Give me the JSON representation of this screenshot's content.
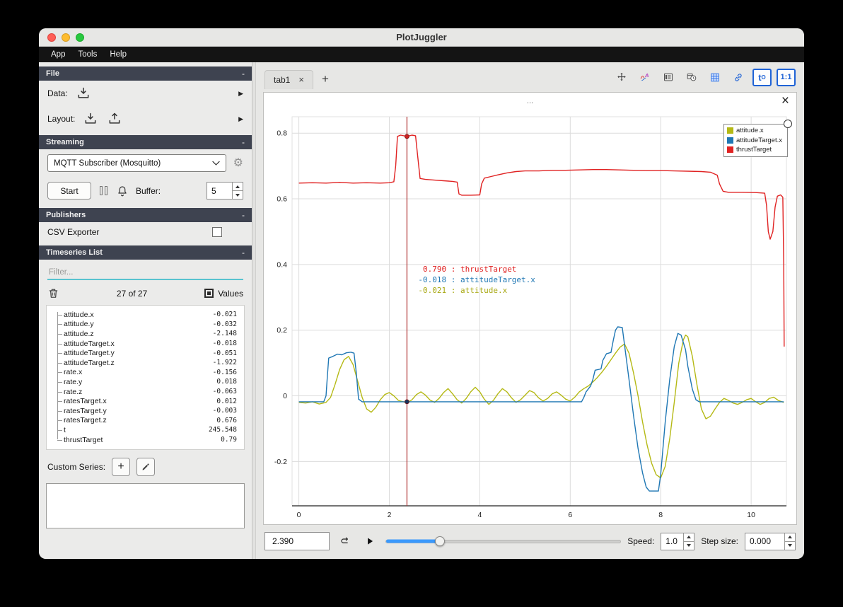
{
  "window": {
    "title": "PlotJuggler"
  },
  "menu": {
    "items": [
      "App",
      "Tools",
      "Help"
    ]
  },
  "icons": {
    "close": "×",
    "plus": "+",
    "expand_arrow": "▶",
    "gear": "⚙"
  },
  "sidebar": {
    "file": {
      "title": "File",
      "collapse": "-",
      "data_label": "Data:",
      "layout_label": "Layout:"
    },
    "streaming": {
      "title": "Streaming",
      "collapse": "-",
      "source": "MQTT Subscriber (Mosquitto)",
      "start_label": "Start",
      "buffer_label": "Buffer:",
      "buffer_value": "5"
    },
    "publishers": {
      "title": "Publishers",
      "collapse": "-",
      "csv_label": "CSV Exporter"
    },
    "timeseries": {
      "title": "Timeseries List",
      "collapse": "-",
      "filter_placeholder": "Filter...",
      "count": "27 of 27",
      "values_label": "Values",
      "items": [
        {
          "name": "attitude.x",
          "value": "-0.021"
        },
        {
          "name": "attitude.y",
          "value": "-0.032"
        },
        {
          "name": "attitude.z",
          "value": "-2.148"
        },
        {
          "name": "attitudeTarget.x",
          "value": "-0.018"
        },
        {
          "name": "attitudeTarget.y",
          "value": "-0.051"
        },
        {
          "name": "attitudeTarget.z",
          "value": "-1.922"
        },
        {
          "name": "rate.x",
          "value": "-0.156"
        },
        {
          "name": "rate.y",
          "value": "0.018"
        },
        {
          "name": "rate.z",
          "value": "-0.063"
        },
        {
          "name": "ratesTarget.x",
          "value": "0.012"
        },
        {
          "name": "ratesTarget.y",
          "value": "-0.003"
        },
        {
          "name": "ratesTarget.z",
          "value": "0.676"
        },
        {
          "name": "t",
          "value": "245.548"
        },
        {
          "name": "thrustTarget",
          "value": "0.79"
        }
      ]
    },
    "custom_series_label": "Custom Series:"
  },
  "main": {
    "tab": {
      "label": "tab1"
    },
    "toolbar": {
      "t0_main": "t",
      "t0_sub": "O",
      "ratio_label": "1:1"
    },
    "plot": {
      "title": "...",
      "legend": [
        {
          "label": "attitude.x",
          "color": "#b5b915"
        },
        {
          "label": "attitudeTarget.x",
          "color": "#1f77b4"
        },
        {
          "label": "thrustTarget",
          "color": "#e02222"
        }
      ],
      "annotation_lines": [
        {
          "text": " 0.790 : thrustTarget",
          "color": "#e02222"
        },
        {
          "text": "-0.018 : attitudeTarget.x",
          "color": "#1f77b4"
        },
        {
          "text": "-0.021 : attitude.x",
          "color": "#a8a812"
        }
      ]
    },
    "controls": {
      "time": "2.390",
      "speed_label": "Speed:",
      "speed": "1.0",
      "step_label": "Step size:",
      "step": "0.000",
      "slider_percent": 23
    }
  },
  "chart_data": {
    "type": "line",
    "title": "...",
    "xlim": [
      -0.15,
      10.78
    ],
    "ylim": [
      -0.335,
      0.85
    ],
    "grid": true,
    "legend_position": "top-right",
    "xticks": [
      {
        "v": 0,
        "label": "0"
      },
      {
        "v": 2,
        "label": "2"
      },
      {
        "v": 4,
        "label": "4"
      },
      {
        "v": 6,
        "label": "6"
      },
      {
        "v": 8,
        "label": "8"
      },
      {
        "v": 10,
        "label": "10"
      }
    ],
    "yticks": [
      {
        "v": -0.2,
        "label": "-0.2"
      },
      {
        "v": 0,
        "label": "0"
      },
      {
        "v": 0.2,
        "label": "0.2"
      },
      {
        "v": 0.4,
        "label": "0.4"
      },
      {
        "v": 0.6,
        "label": "0.6"
      },
      {
        "v": 0.8,
        "label": "0.8"
      }
    ],
    "tracker": {
      "x": 2.39,
      "line_color": "#b03030",
      "dots": [
        {
          "y": 0.79,
          "color": "#c22"
        },
        {
          "y": -0.018,
          "color": "#17345c"
        }
      ]
    },
    "series": [
      {
        "name": "attitude.x",
        "color": "#b5b915",
        "points": [
          [
            0,
            -0.02
          ],
          [
            0.15,
            -0.022
          ],
          [
            0.3,
            -0.018
          ],
          [
            0.45,
            -0.025
          ],
          [
            0.6,
            -0.02
          ],
          [
            0.7,
            -0.005
          ],
          [
            0.8,
            0.035
          ],
          [
            0.9,
            0.08
          ],
          [
            1.0,
            0.11
          ],
          [
            1.1,
            0.12
          ],
          [
            1.2,
            0.095
          ],
          [
            1.3,
            0.045
          ],
          [
            1.4,
            -0.005
          ],
          [
            1.5,
            -0.04
          ],
          [
            1.6,
            -0.05
          ],
          [
            1.7,
            -0.035
          ],
          [
            1.8,
            -0.012
          ],
          [
            1.9,
            0.004
          ],
          [
            2.0,
            0.01
          ],
          [
            2.1,
            0.0
          ],
          [
            2.2,
            -0.014
          ],
          [
            2.39,
            -0.021
          ],
          [
            2.5,
            -0.012
          ],
          [
            2.6,
            0.004
          ],
          [
            2.7,
            0.012
          ],
          [
            2.8,
            0.002
          ],
          [
            2.9,
            -0.013
          ],
          [
            3.0,
            -0.02
          ],
          [
            3.1,
            -0.008
          ],
          [
            3.2,
            0.01
          ],
          [
            3.3,
            0.022
          ],
          [
            3.4,
            0.006
          ],
          [
            3.5,
            -0.012
          ],
          [
            3.6,
            -0.022
          ],
          [
            3.7,
            -0.008
          ],
          [
            3.8,
            0.012
          ],
          [
            3.9,
            0.026
          ],
          [
            4.0,
            0.012
          ],
          [
            4.1,
            -0.01
          ],
          [
            4.2,
            -0.026
          ],
          [
            4.3,
            -0.014
          ],
          [
            4.4,
            0.006
          ],
          [
            4.5,
            0.022
          ],
          [
            4.6,
            0.012
          ],
          [
            4.7,
            -0.006
          ],
          [
            4.8,
            -0.02
          ],
          [
            4.9,
            -0.012
          ],
          [
            5.0,
            0.002
          ],
          [
            5.1,
            0.016
          ],
          [
            5.2,
            0.01
          ],
          [
            5.3,
            -0.006
          ],
          [
            5.4,
            -0.016
          ],
          [
            5.5,
            -0.008
          ],
          [
            5.6,
            0.006
          ],
          [
            5.7,
            0.012
          ],
          [
            5.8,
            0.002
          ],
          [
            5.9,
            -0.01
          ],
          [
            6.0,
            -0.016
          ],
          [
            6.1,
            -0.004
          ],
          [
            6.2,
            0.012
          ],
          [
            6.3,
            0.022
          ],
          [
            6.4,
            0.03
          ],
          [
            6.5,
            0.042
          ],
          [
            6.6,
            0.056
          ],
          [
            6.7,
            0.072
          ],
          [
            6.8,
            0.09
          ],
          [
            6.9,
            0.11
          ],
          [
            7.0,
            0.13
          ],
          [
            7.1,
            0.148
          ],
          [
            7.2,
            0.158
          ],
          [
            7.3,
            0.13
          ],
          [
            7.4,
            0.07
          ],
          [
            7.5,
            0.0
          ],
          [
            7.6,
            -0.08
          ],
          [
            7.7,
            -0.15
          ],
          [
            7.8,
            -0.205
          ],
          [
            7.9,
            -0.24
          ],
          [
            8.0,
            -0.25
          ],
          [
            8.1,
            -0.215
          ],
          [
            8.2,
            -0.13
          ],
          [
            8.3,
            -0.02
          ],
          [
            8.4,
            0.1
          ],
          [
            8.5,
            0.17
          ],
          [
            8.55,
            0.185
          ],
          [
            8.6,
            0.18
          ],
          [
            8.7,
            0.12
          ],
          [
            8.8,
            0.035
          ],
          [
            8.9,
            -0.04
          ],
          [
            9.0,
            -0.07
          ],
          [
            9.1,
            -0.062
          ],
          [
            9.2,
            -0.04
          ],
          [
            9.3,
            -0.02
          ],
          [
            9.4,
            -0.008
          ],
          [
            9.5,
            -0.014
          ],
          [
            9.6,
            -0.022
          ],
          [
            9.7,
            -0.026
          ],
          [
            9.8,
            -0.02
          ],
          [
            9.9,
            -0.012
          ],
          [
            10.0,
            -0.008
          ],
          [
            10.1,
            -0.018
          ],
          [
            10.2,
            -0.026
          ],
          [
            10.3,
            -0.02
          ],
          [
            10.4,
            -0.008
          ],
          [
            10.5,
            -0.004
          ],
          [
            10.6,
            -0.014
          ],
          [
            10.72,
            -0.02
          ]
        ]
      },
      {
        "name": "attitudeTarget.x",
        "color": "#1f77b4",
        "points": [
          [
            0,
            -0.018
          ],
          [
            0.55,
            -0.018
          ],
          [
            0.6,
            0.0
          ],
          [
            0.63,
            0.06
          ],
          [
            0.66,
            0.115
          ],
          [
            0.75,
            0.12
          ],
          [
            0.85,
            0.127
          ],
          [
            0.95,
            0.125
          ],
          [
            1.05,
            0.131
          ],
          [
            1.15,
            0.133
          ],
          [
            1.22,
            0.13
          ],
          [
            1.27,
            0.07
          ],
          [
            1.32,
            -0.01
          ],
          [
            1.4,
            -0.018
          ],
          [
            2.5,
            -0.018
          ],
          [
            4.0,
            -0.018
          ],
          [
            5.5,
            -0.018
          ],
          [
            6.25,
            -0.018
          ],
          [
            6.3,
            -0.005
          ],
          [
            6.35,
            0.012
          ],
          [
            6.45,
            0.03
          ],
          [
            6.5,
            0.05
          ],
          [
            6.55,
            0.078
          ],
          [
            6.68,
            0.082
          ],
          [
            6.72,
            0.108
          ],
          [
            6.8,
            0.128
          ],
          [
            6.9,
            0.132
          ],
          [
            6.95,
            0.168
          ],
          [
            7.0,
            0.2
          ],
          [
            7.05,
            0.21
          ],
          [
            7.15,
            0.208
          ],
          [
            7.2,
            0.155
          ],
          [
            7.3,
            0.05
          ],
          [
            7.4,
            -0.06
          ],
          [
            7.5,
            -0.16
          ],
          [
            7.6,
            -0.235
          ],
          [
            7.68,
            -0.278
          ],
          [
            7.75,
            -0.29
          ],
          [
            7.95,
            -0.29
          ],
          [
            8.0,
            -0.24
          ],
          [
            8.05,
            -0.16
          ],
          [
            8.1,
            -0.08
          ],
          [
            8.2,
            0.05
          ],
          [
            8.3,
            0.15
          ],
          [
            8.38,
            0.19
          ],
          [
            8.45,
            0.185
          ],
          [
            8.55,
            0.14
          ],
          [
            8.6,
            0.09
          ],
          [
            8.7,
            0.02
          ],
          [
            8.78,
            -0.012
          ],
          [
            8.85,
            -0.018
          ],
          [
            9.5,
            -0.018
          ],
          [
            10.72,
            -0.018
          ]
        ]
      },
      {
        "name": "thrustTarget",
        "color": "#e02222",
        "points": [
          [
            0,
            0.648
          ],
          [
            0.3,
            0.649
          ],
          [
            0.6,
            0.648
          ],
          [
            0.9,
            0.65
          ],
          [
            1.2,
            0.648
          ],
          [
            1.5,
            0.649
          ],
          [
            1.8,
            0.648
          ],
          [
            2.0,
            0.649
          ],
          [
            2.1,
            0.652
          ],
          [
            2.14,
            0.7
          ],
          [
            2.18,
            0.79
          ],
          [
            2.25,
            0.794
          ],
          [
            2.39,
            0.79
          ],
          [
            2.5,
            0.794
          ],
          [
            2.58,
            0.792
          ],
          [
            2.62,
            0.74
          ],
          [
            2.68,
            0.662
          ],
          [
            2.8,
            0.659
          ],
          [
            3.0,
            0.657
          ],
          [
            3.2,
            0.655
          ],
          [
            3.4,
            0.653
          ],
          [
            3.5,
            0.651
          ],
          [
            3.54,
            0.615
          ],
          [
            3.6,
            0.611
          ],
          [
            3.8,
            0.611
          ],
          [
            4.0,
            0.612
          ],
          [
            4.04,
            0.645
          ],
          [
            4.1,
            0.663
          ],
          [
            4.25,
            0.668
          ],
          [
            4.4,
            0.673
          ],
          [
            4.6,
            0.679
          ],
          [
            4.8,
            0.683
          ],
          [
            5.0,
            0.685
          ],
          [
            5.3,
            0.685
          ],
          [
            5.6,
            0.687
          ],
          [
            5.9,
            0.687
          ],
          [
            6.2,
            0.688
          ],
          [
            6.5,
            0.689
          ],
          [
            6.8,
            0.689
          ],
          [
            7.1,
            0.688
          ],
          [
            7.4,
            0.687
          ],
          [
            7.7,
            0.686
          ],
          [
            8.0,
            0.686
          ],
          [
            8.3,
            0.685
          ],
          [
            8.6,
            0.684
          ],
          [
            8.9,
            0.683
          ],
          [
            9.1,
            0.681
          ],
          [
            9.25,
            0.672
          ],
          [
            9.3,
            0.645
          ],
          [
            9.38,
            0.623
          ],
          [
            9.5,
            0.62
          ],
          [
            9.8,
            0.62
          ],
          [
            10.1,
            0.619
          ],
          [
            10.3,
            0.617
          ],
          [
            10.34,
            0.58
          ],
          [
            10.38,
            0.5
          ],
          [
            10.42,
            0.477
          ],
          [
            10.48,
            0.5
          ],
          [
            10.53,
            0.575
          ],
          [
            10.58,
            0.608
          ],
          [
            10.65,
            0.612
          ],
          [
            10.7,
            0.605
          ],
          [
            10.72,
            0.4
          ],
          [
            10.73,
            0.15
          ]
        ]
      }
    ]
  }
}
